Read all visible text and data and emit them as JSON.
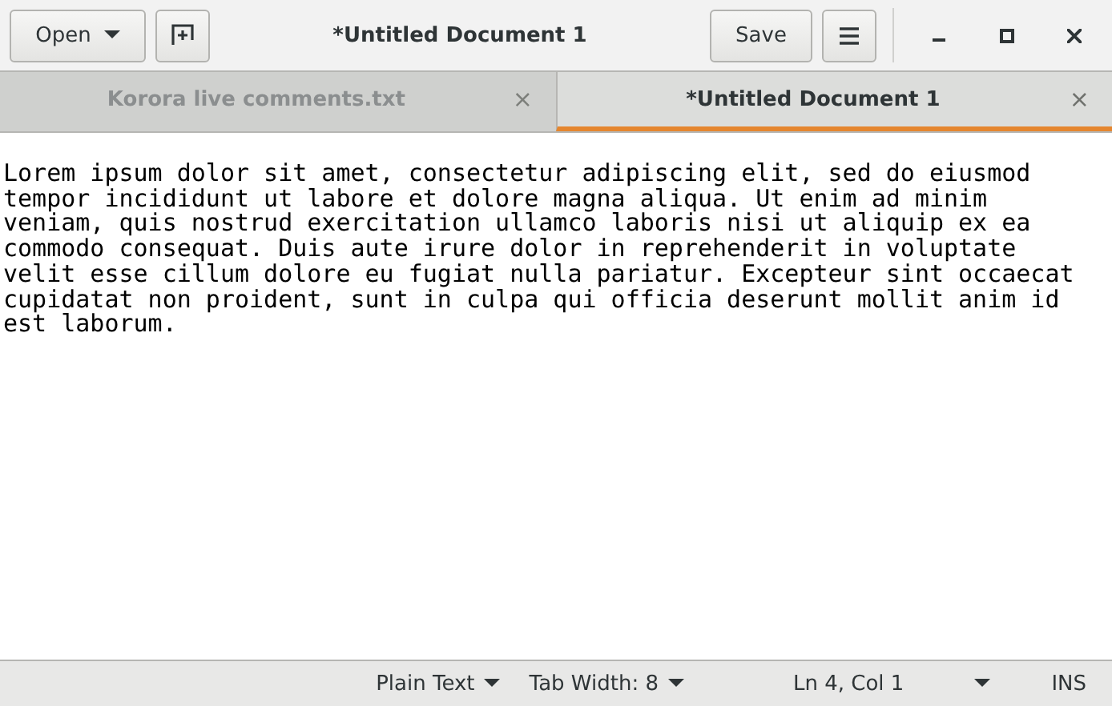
{
  "header": {
    "open_button": "Open",
    "title": "*Untitled Document 1",
    "save_button": "Save"
  },
  "tabs": [
    {
      "label": "Korora live comments.txt",
      "selected": false,
      "close": "×"
    },
    {
      "label": "*Untitled Document 1",
      "selected": true,
      "close": "×"
    }
  ],
  "document": {
    "text": "Lorem ipsum dolor sit amet, consectetur adipiscing elit, sed do eiusmod tempor incididunt ut labore et dolore magna aliqua. Ut enim ad minim veniam, quis nostrud exercitation ullamco laboris nisi ut aliquip ex ea commodo consequat. Duis aute irure dolor in reprehenderit in voluptate velit esse cillum dolore eu fugiat nulla pariatur. Excepteur sint occaecat cupidatat non proident, sunt in culpa qui officia deserunt mollit anim id est laborum."
  },
  "status_bar": {
    "language": "Plain Text",
    "tab_width": "Tab Width: 8",
    "position": "Ln 4, Col 1",
    "mode": "INS"
  }
}
